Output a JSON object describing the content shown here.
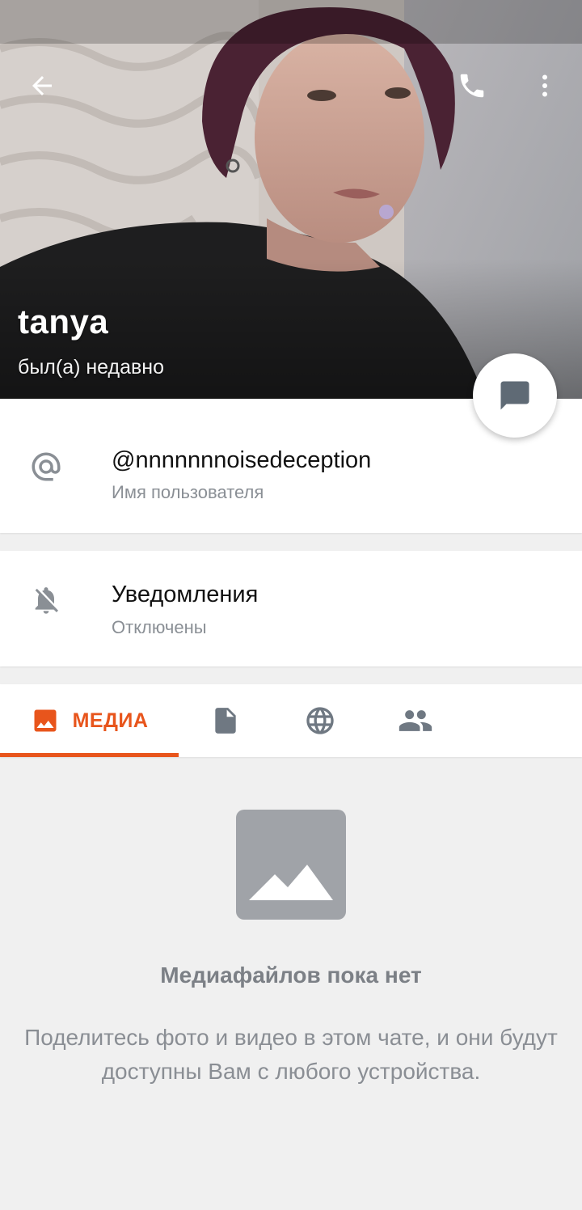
{
  "header": {
    "name": "tanya",
    "status": "был(а) недавно"
  },
  "icons": {
    "back": "back-arrow-icon",
    "call": "phone-icon",
    "more": "more-vertical-icon",
    "message": "chat-bubble-icon",
    "username": "at-sign-icon",
    "notifications": "bell-off-icon",
    "media_tab": "image-icon",
    "files_tab": "document-icon",
    "links_tab": "globe-icon",
    "members_tab": "group-icon",
    "empty_state": "image-placeholder-icon"
  },
  "username": {
    "value": "@nnnnnnnoisedeception",
    "label": "Имя пользователя"
  },
  "notifications": {
    "title": "Уведомления",
    "value": "Отключены"
  },
  "tabs": [
    {
      "label": "МЕДИА",
      "selected": true
    },
    {
      "label": "",
      "selected": false
    },
    {
      "label": "",
      "selected": false
    },
    {
      "label": "",
      "selected": false
    }
  ],
  "empty_state": {
    "title": "Медиафайлов пока нет",
    "description": "Поделитесь фото и видео в этом чате, и они будут доступны Вам с любого устройства."
  },
  "colors": {
    "accent": "#e8551c",
    "icon_gray": "#8a8f95"
  }
}
